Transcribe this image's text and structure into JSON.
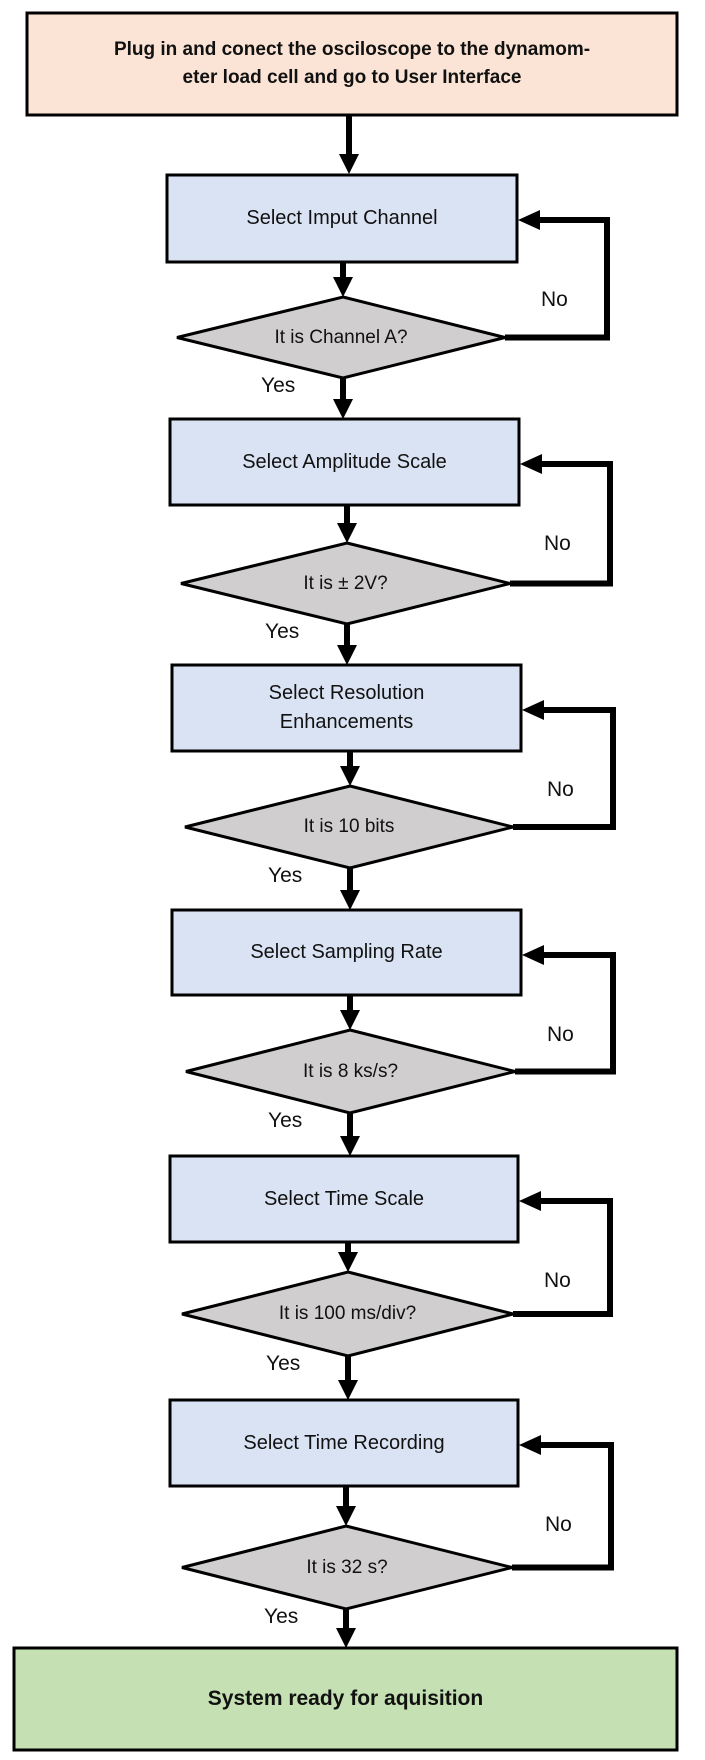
{
  "diagram": {
    "type": "flowchart",
    "colors": {
      "start_fill": "#fbe4d5",
      "step_fill": "#dae3f3",
      "decision_fill": "#d0cece",
      "end_fill": "#c5e0b3",
      "stroke": "#000000"
    },
    "start": {
      "text_line1": "Plug in and conect the osciloscope to the dynamom-",
      "text_line2": "eter load cell and go to User Interface"
    },
    "steps": [
      {
        "process": "Select Imput Channel",
        "process_line2": "",
        "decision": "It is Channel A?",
        "yes_label": "Yes",
        "no_label": "No"
      },
      {
        "process": "Select Amplitude Scale",
        "process_line2": "",
        "decision": "It is ± 2V?",
        "yes_label": "Yes",
        "no_label": "No"
      },
      {
        "process": "Select Resolution",
        "process_line2": "Enhancements",
        "decision": "It is 10 bits",
        "yes_label": "Yes",
        "no_label": "No"
      },
      {
        "process": "Select Sampling Rate",
        "process_line2": "",
        "decision": "It is 8 ks/s?",
        "yes_label": "Yes",
        "no_label": "No"
      },
      {
        "process": "Select Time Scale",
        "process_line2": "",
        "decision": "It is 100 ms/div?",
        "yes_label": "Yes",
        "no_label": "No"
      },
      {
        "process": "Select Time Recording",
        "process_line2": "",
        "decision": "It is 32 s?",
        "yes_label": "Yes",
        "no_label": "No"
      }
    ],
    "end": {
      "text": "System ready for aquisition"
    }
  }
}
